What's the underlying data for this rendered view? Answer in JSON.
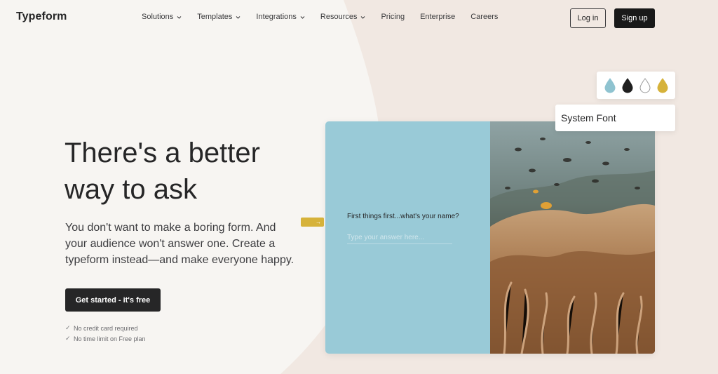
{
  "brand": {
    "logo_text": "Typeform"
  },
  "nav": {
    "items": [
      {
        "label": "Solutions",
        "has_dropdown": true
      },
      {
        "label": "Templates",
        "has_dropdown": true
      },
      {
        "label": "Integrations",
        "has_dropdown": true
      },
      {
        "label": "Resources",
        "has_dropdown": true
      },
      {
        "label": "Pricing",
        "has_dropdown": false
      },
      {
        "label": "Enterprise",
        "has_dropdown": false
      },
      {
        "label": "Careers",
        "has_dropdown": false
      }
    ],
    "login_label": "Log in",
    "signup_label": "Sign up"
  },
  "hero": {
    "title_line1": "There's a better",
    "title_line2": "way to ask",
    "subtitle_line1": "You don't want to make a boring form. And",
    "subtitle_line2": "your audience won't answer one. Create a",
    "subtitle_line3": "typeform instead—and make everyone happy.",
    "cta_label": "Get started - it's free",
    "checks": [
      "No credit card required",
      "No time limit on Free plan"
    ]
  },
  "preview": {
    "question": "First things first...what's your name?",
    "input_placeholder": "Type your answer here...",
    "swatch_colors": [
      "#8fc3d0",
      "#1f1f1f",
      "#ffffff",
      "#d6b23a"
    ],
    "font_label": "System Font"
  },
  "colors": {
    "page_bg": "#f7f5f2",
    "accent_shape": "#f1e8e2",
    "card_left_bg": "#99cad7",
    "dark_button": "#262627"
  }
}
